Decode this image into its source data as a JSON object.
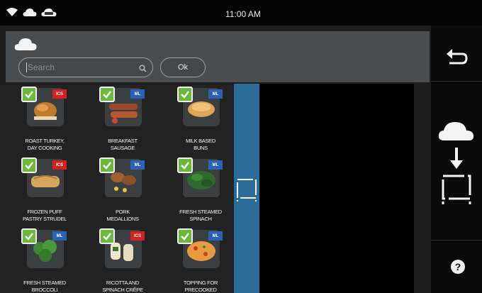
{
  "status_bar": {
    "time": "11:00 AM",
    "icons": [
      "wifi-icon",
      "cloud-icon",
      "cloud-badge-icon"
    ]
  },
  "header": {
    "icon": "cloud-icon"
  },
  "search": {
    "placeholder": "Search",
    "value": ""
  },
  "ok_label": "Ok",
  "items": [
    {
      "label_1": "ROAST TURKEY,",
      "label_2": "DAY COOKING",
      "badge": "ICS",
      "checked": true,
      "food": "turkey"
    },
    {
      "label_1": "BREAKFAST",
      "label_2": "SAUSAGE",
      "badge": "ML",
      "checked": true,
      "food": "sausage"
    },
    {
      "label_1": "MILK BASED",
      "label_2": "BUNS",
      "badge": "ML",
      "checked": true,
      "food": "buns"
    },
    {
      "label_1": "FROZEN PUFF",
      "label_2": "PASTRY STRUDEL",
      "badge": "ICS",
      "checked": true,
      "food": "strudel"
    },
    {
      "label_1": "PORK",
      "label_2": "MEDALLIONS",
      "badge": "ML",
      "checked": true,
      "food": "pork"
    },
    {
      "label_1": "FRESH STEAMED",
      "label_2": "SPINACH",
      "badge": "ML",
      "checked": true,
      "food": "spinach"
    },
    {
      "label_1": "FRESH STEAMED",
      "label_2": "BROCCOLI",
      "badge": "ML",
      "checked": true,
      "food": "broccoli"
    },
    {
      "label_1": "RICOTTA AND",
      "label_2": "SPINACH CRÊPE",
      "badge": "ICS",
      "checked": true,
      "food": "crepe"
    },
    {
      "label_1": "TOPPING FOR",
      "label_2": "PRECOOKED",
      "badge": "ML",
      "checked": true,
      "food": "topping"
    }
  ],
  "sidebar": {
    "back": "back-arrow-icon",
    "transfer": "cloud-to-device-icon",
    "help": "?"
  },
  "colors": {
    "accent_blue": "#2d6b98",
    "check_green": "#6bb83c",
    "ics_red": "#d42020",
    "ml_blue": "#2a62b8"
  }
}
